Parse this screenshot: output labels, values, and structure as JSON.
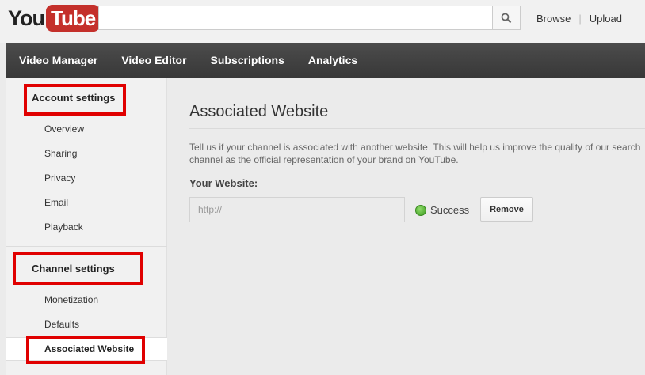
{
  "header": {
    "logo_you": "You",
    "logo_tube": "Tube",
    "search_placeholder": "",
    "links": [
      "Browse",
      "Upload"
    ]
  },
  "nav": {
    "items": [
      "Video Manager",
      "Video Editor",
      "Subscriptions",
      "Analytics"
    ]
  },
  "sidebar": {
    "account_heading": "Account settings",
    "account_items": [
      "Overview",
      "Sharing",
      "Privacy",
      "Email",
      "Playback"
    ],
    "channel_heading": "Channel settings",
    "channel_items": [
      "Monetization",
      "Defaults"
    ],
    "active_item": "Associated Website"
  },
  "main": {
    "title": "Associated Website",
    "description_line1": "Tell us if your channel is associated with another website. This will help us improve the quality of our search",
    "description_line2": "channel as the official representation of your brand on YouTube.",
    "website_label": "Your Website:",
    "website_value": "http://",
    "status_text": "Success",
    "remove_label": "Remove"
  },
  "colors": {
    "highlight_box": "#e00000",
    "success": "#3c9a1f",
    "logo_red": "#c4302b"
  }
}
